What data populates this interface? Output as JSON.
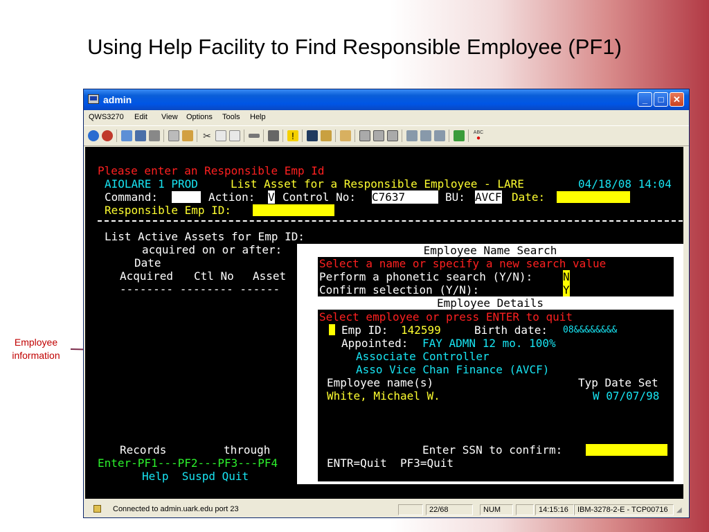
{
  "slide": {
    "title": "Using Help Facility to Find Responsible Employee (PF1)",
    "callout": "Employee information"
  },
  "window": {
    "title": "admin",
    "menu": [
      "QWS3270",
      "Edit",
      "View",
      "Options",
      "Tools",
      "Help"
    ]
  },
  "terminal": {
    "prompt": "Please enter an Responsible Emp Id",
    "system": "AIOLARE 1 PROD",
    "screen_title": "List Asset for a Responsible Employee - LARE",
    "datetime": "04/18/08 14:04",
    "command_label": "Command:",
    "action_label": "Action:",
    "action_value": "V",
    "control_label": "Control No:",
    "control_value": "C7637",
    "bu_label": "BU:",
    "bu_value": "AVCF",
    "date_label": "Date:",
    "resp_label": "Responsible Emp ID:",
    "list_title": "List Active Assets for Emp ID:",
    "acquired_label": "acquired on or after:",
    "col_date": "Date",
    "col_acquired": "Acquired",
    "col_ctl": "Ctl No",
    "col_asset": "Asset",
    "col_dashes": "-------- -------- ------",
    "records_label": "Records",
    "through_label": "through",
    "pf_keys": "Enter-PF1---PF2---PF3---PF4",
    "pf_labels": "Help  Suspd Quit"
  },
  "name_search": {
    "header": "Employee Name Search",
    "instruction": "Select a name or specify a new search value",
    "phonetic_label": "Perform a phonetic search (Y/N):",
    "phonetic_value": "N",
    "confirm_label": "Confirm selection (Y/N):",
    "confirm_value": "Y"
  },
  "details": {
    "header": "Employee Details",
    "instruction": "Select employee or press ENTER to quit",
    "emp_id_label": "Emp ID:",
    "emp_id": "142599",
    "birth_label": "Birth date:",
    "birth_value": "08&&&&&&&&",
    "appointed_label": "Appointed:",
    "appointed_value": "FAY ADMN 12 mo. 100%",
    "position": "Associate Controller",
    "department": "Asso Vice Chan Finance (AVCF)",
    "names_label": "Employee name(s)",
    "typ_label": "Typ Date Set",
    "name_value": "White, Michael W.",
    "typ_value": "W 07/07/98",
    "ssn_label": "Enter SSN to confirm:",
    "footer": "ENTR=Quit  PF3=Quit"
  },
  "status": {
    "connection": "Connected to admin.uark.edu port 23",
    "cursor": "22/68",
    "num": "NUM",
    "time": "14:15:16",
    "terminal": "IBM-3278-2-E - TCP00716"
  },
  "colors": {
    "red": "#ff2020",
    "cyan": "#18e4f2",
    "yellow": "#ffff30",
    "green": "#2cf02c",
    "callout": "#c00000"
  }
}
